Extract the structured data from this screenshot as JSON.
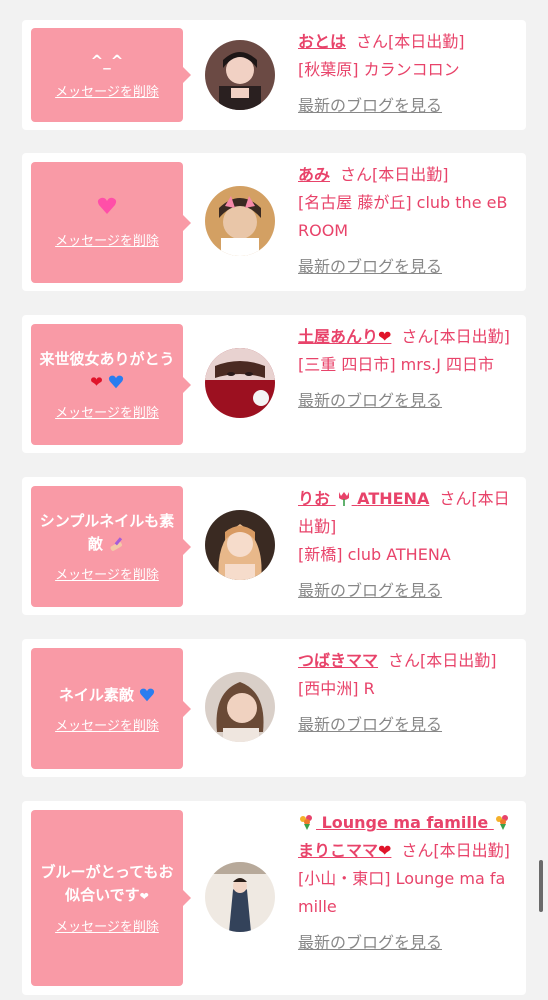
{
  "cards": [
    {
      "message": "^_^",
      "delete_label": "メッセージを削除",
      "name": "おとは",
      "san_label": "さん[本日出勤]",
      "shop": "[秋葉原] カランコロン",
      "blog_label": "最新のブログを見る"
    },
    {
      "message_icon": "💗",
      "delete_label": "メッセージを削除",
      "name": "あみ",
      "san_label": "さん[本日出勤]",
      "shop": "[名古屋 藤が丘] club the eBROOM",
      "blog_label": "最新のブログを見る"
    },
    {
      "message": "来世彼女ありがとう",
      "delete_label": "メッセージを削除",
      "name": "土屋あんり",
      "san_label": "さん[本日出勤]",
      "shop": "[三重 四日市] mrs.J 四日市",
      "blog_label": "最新のブログを見る"
    },
    {
      "message": "シンプルネイルも素敵",
      "delete_label": "メッセージを削除",
      "name_prefix": "りお",
      "name": "ATHENA",
      "san_label": "さん[本日出勤]",
      "shop": "[新橋] club ATHENA",
      "blog_label": "最新のブログを見る"
    },
    {
      "message": "ネイル素敵",
      "delete_label": "メッセージを削除",
      "name": "つばきママ",
      "san_label": "さん[本日出勤]",
      "shop": "[西中洲] R",
      "blog_label": "最新のブログを見る"
    },
    {
      "message": "ブルーがとってもお似合いです",
      "delete_label": "メッセージを削除",
      "name_line1": "Lounge ma famille",
      "name": "まりこママ",
      "san_label": "さん[本日出勤]",
      "shop": "[小山・東口] Lounge ma famille",
      "blog_label": "最新のブログを見る"
    }
  ],
  "icons": {
    "heart_red": "❤",
    "heart_blue": "💙",
    "heart_pink": "❤",
    "flower": "✿",
    "nail_polish": "💅"
  }
}
